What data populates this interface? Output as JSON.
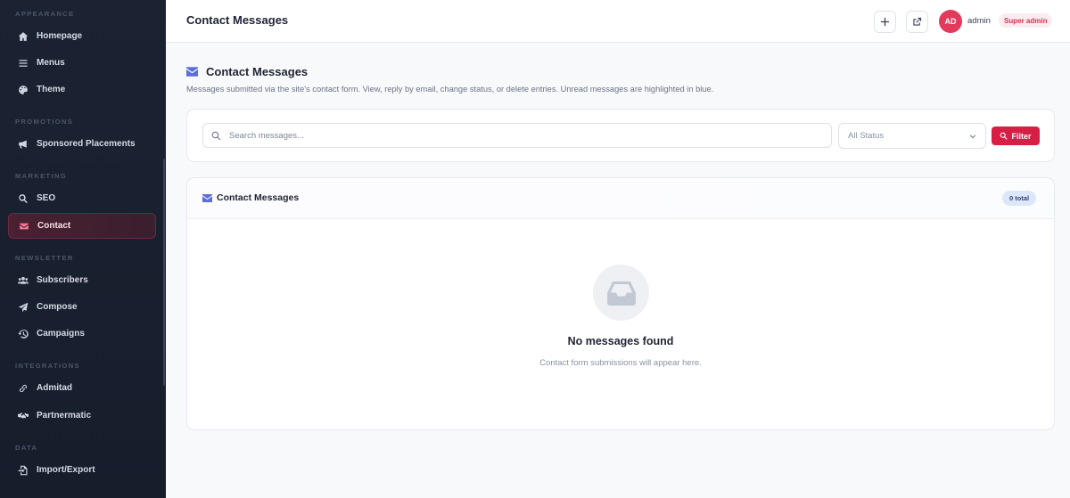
{
  "sidebar": {
    "sections": [
      {
        "label": "APPEARANCE",
        "items": [
          {
            "label": "Homepage",
            "icon": "home-icon"
          },
          {
            "label": "Menus",
            "icon": "list-icon"
          },
          {
            "label": "Theme",
            "icon": "palette-icon"
          }
        ]
      },
      {
        "label": "PROMOTIONS",
        "items": [
          {
            "label": "Sponsored Placements",
            "icon": "megaphone-icon"
          }
        ]
      },
      {
        "label": "MARKETING",
        "items": [
          {
            "label": "SEO",
            "icon": "search-icon"
          },
          {
            "label": "Contact",
            "icon": "envelope-icon",
            "active": true
          }
        ]
      },
      {
        "label": "NEWSLETTER",
        "items": [
          {
            "label": "Subscribers",
            "icon": "users-icon"
          },
          {
            "label": "Compose",
            "icon": "paper-plane-icon"
          },
          {
            "label": "Campaigns",
            "icon": "history-icon"
          }
        ]
      },
      {
        "label": "INTEGRATIONS",
        "items": [
          {
            "label": "Admitad",
            "icon": "link-icon"
          },
          {
            "label": "Partnermatic",
            "icon": "handshake-icon"
          }
        ]
      },
      {
        "label": "DATA",
        "items": [
          {
            "label": "Import/Export",
            "icon": "file-import-icon"
          }
        ]
      }
    ]
  },
  "header": {
    "title": "Contact Messages",
    "avatar_initials": "AD",
    "username": "admin",
    "role": "Super admin"
  },
  "main": {
    "title": "Contact Messages",
    "description": "Messages submitted via the site's contact form. View, reply by email, change status, or delete entries. Unread messages are highlighted in blue.",
    "search_placeholder": "Search messages...",
    "status_selected": "All Status",
    "filter_label": "Filter",
    "list_title": "Contact Messages",
    "total_label": "0 total",
    "empty_title": "No messages found",
    "empty_subtitle": "Contact form submissions will appear here."
  },
  "colors": {
    "accent": "#d71f45",
    "icon_blue": "#5b6fd6",
    "sidebar_bg": "#1b2333"
  }
}
